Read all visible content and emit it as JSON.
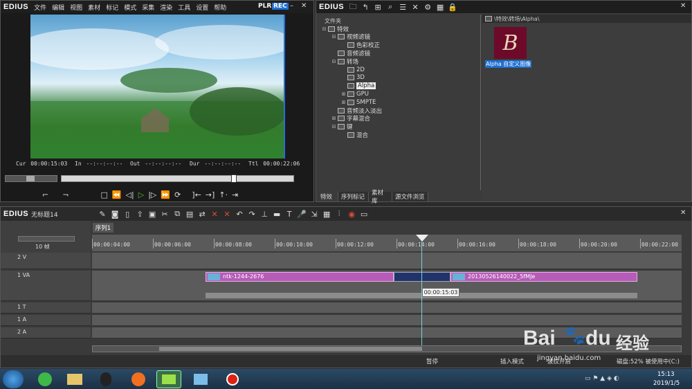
{
  "player": {
    "logo": "EDIUS",
    "menu": [
      "文件",
      "编辑",
      "视图",
      "素材",
      "标记",
      "模式",
      "采集",
      "渲染",
      "工具",
      "设置",
      "帮助"
    ],
    "plr": "PLR",
    "rec": "REC",
    "cur_label": "Cur",
    "cur_value": "00:00:15:03",
    "in_label": "In",
    "in_value": "--:--:--:--",
    "out_label": "Out",
    "out_value": "--:--:--:--",
    "dur_label": "Dur",
    "dur_value": "--:--:--:--",
    "ttl_label": "Ttl",
    "ttl_value": "00:00:22:06",
    "scrub_position": 0.74
  },
  "library": {
    "logo": "EDIUS",
    "tree_header": "文件夹",
    "tree": [
      {
        "label": "特效",
        "level": 0,
        "exp": "⊟"
      },
      {
        "label": "视频滤镜",
        "level": 1,
        "exp": "⊟"
      },
      {
        "label": "色彩校正",
        "level": 2,
        "exp": ""
      },
      {
        "label": "音频滤镜",
        "level": 1,
        "exp": ""
      },
      {
        "label": "转场",
        "level": 1,
        "exp": "⊟"
      },
      {
        "label": "2D",
        "level": 2,
        "exp": ""
      },
      {
        "label": "3D",
        "level": 2,
        "exp": ""
      },
      {
        "label": "Alpha",
        "level": 2,
        "exp": "",
        "selected": true
      },
      {
        "label": "GPU",
        "level": 2,
        "exp": "⊞"
      },
      {
        "label": "SMPTE",
        "level": 2,
        "exp": "⊞"
      },
      {
        "label": "音频淡入淡出",
        "level": 1,
        "exp": ""
      },
      {
        "label": "字幕混合",
        "level": 1,
        "exp": "⊞"
      },
      {
        "label": "键",
        "level": 1,
        "exp": "⊟"
      },
      {
        "label": "混合",
        "level": 2,
        "exp": ""
      }
    ],
    "path": "\\特效\\转场\\Alpha\\",
    "item_letter": "B",
    "item_label": "Alpha 自定义图像",
    "tabs": [
      "特效",
      "序列标记",
      "素材库",
      "源文件浏览"
    ]
  },
  "timeline": {
    "logo": "EDIUS",
    "project_name": "无标题14",
    "sequence_tab": "序列1",
    "zoom_label": "10 帧",
    "ruler": [
      "00:00:04:00",
      "00:00:06:00",
      "00:00:08:00",
      "00:00:10:00",
      "00:00:12:00",
      "00:00:14:00",
      "00:00:16:00",
      "00:00:18:00",
      "00:00:20:00",
      "00:00:22:00"
    ],
    "tracks": [
      {
        "name": "2 V"
      },
      {
        "name": "1 VA"
      },
      {
        "name": "1 T"
      },
      {
        "name": "1 A"
      },
      {
        "name": "2 A"
      }
    ],
    "clip1": "ntk-1244-2676",
    "clip2": "20130526140022_5fMJe",
    "tooltip": "00:00:15:03",
    "status": [
      "暂停",
      "插入模式",
      "波纹开启",
      "磁盘:52% 被使用中(C:)"
    ]
  },
  "taskbar": {
    "time": "15:13",
    "date": "2019/1/5"
  },
  "watermark": {
    "brand": "Bai",
    "brand2": "du",
    "cn": "经验",
    "url": "jingyan.baidu.com"
  },
  "colors": {
    "accent": "#1f6fd1",
    "clip": "#b65bb7",
    "playhead": "#7fd0d8"
  }
}
